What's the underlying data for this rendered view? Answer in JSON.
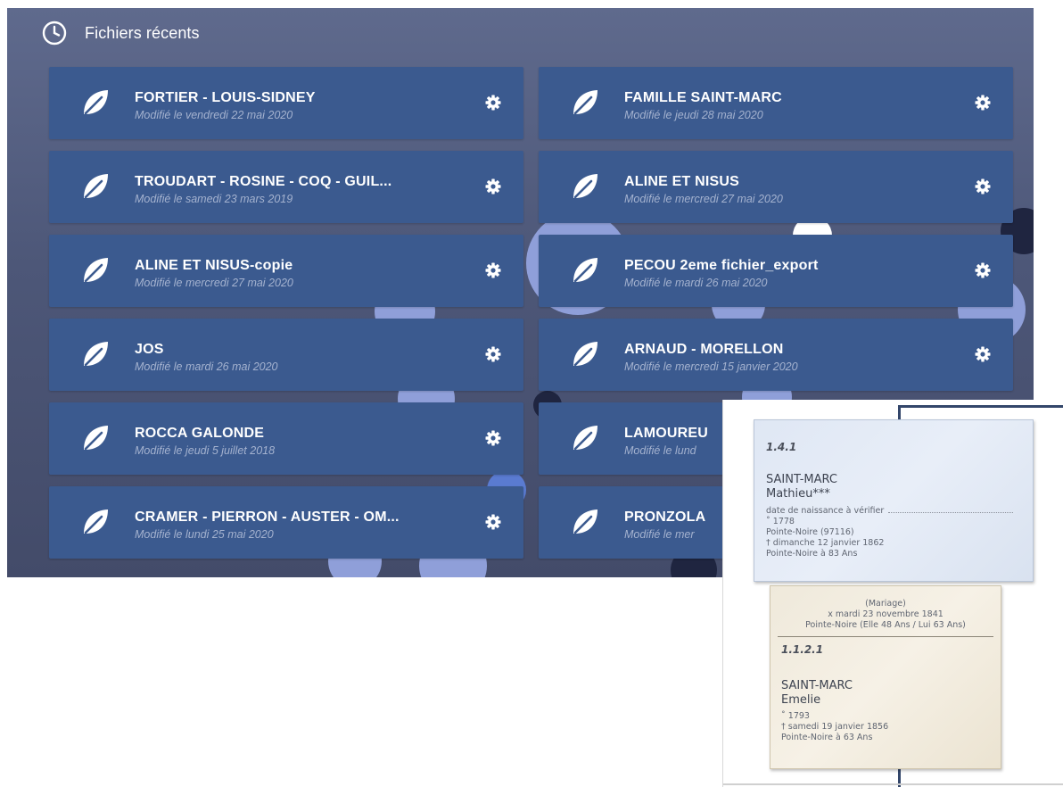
{
  "panel": {
    "title": "Fichiers récents",
    "files": [
      {
        "title": "FORTIER - LOUIS-SIDNEY",
        "modified": "Modifié le vendredi 22 mai 2020"
      },
      {
        "title": "FAMILLE SAINT-MARC",
        "modified": "Modifié le jeudi 28 mai 2020"
      },
      {
        "title": "TROUDART - ROSINE - COQ - GUIL...",
        "modified": "Modifié le samedi 23 mars 2019"
      },
      {
        "title": "ALINE ET NISUS",
        "modified": "Modifié le mercredi 27 mai 2020"
      },
      {
        "title": "ALINE ET NISUS-copie",
        "modified": "Modifié le mercredi 27 mai 2020"
      },
      {
        "title": "PECOU 2eme fichier_export",
        "modified": "Modifié le mardi 26 mai 2020"
      },
      {
        "title": "JOS",
        "modified": "Modifié le mardi 26 mai 2020"
      },
      {
        "title": "ARNAUD - MORELLON",
        "modified": "Modifié le mercredi 15 janvier 2020"
      },
      {
        "title": "ROCCA GALONDE",
        "modified": "Modifié le jeudi 5 juillet 2018"
      },
      {
        "title": "LAMOUREU",
        "modified": "Modifié le lund"
      },
      {
        "title": "CRAMER - PIERRON - AUSTER - OM...",
        "modified": "Modifié le lundi 25 mai 2020"
      },
      {
        "title": "PRONZOLA",
        "modified": "Modifié le mer"
      }
    ],
    "icons": {
      "header": "clock-icon",
      "file": "leaf-icon",
      "settings": "gear-icon"
    }
  },
  "tree": {
    "person1": {
      "code": "1.4.1",
      "surname": "SAINT-MARC",
      "given": "Mathieu***",
      "lines": [
        "date de naissance à vérifier",
        "˚ 1778",
        "Pointe-Noire (97116)",
        "† dimanche 12 janvier 1862",
        "Pointe-Noire à 83 Ans"
      ]
    },
    "marriage": [
      "(Mariage)",
      "x mardi 23 novembre 1841",
      "Pointe-Noire (Elle 48 Ans / Lui 63 Ans)"
    ],
    "person2": {
      "code": "1.1.2.1",
      "surname": "SAINT-MARC",
      "given": "Emelie",
      "lines": [
        "˚ 1793",
        "† samedi 19 janvier 1856",
        "Pointe-Noire à 63 Ans"
      ]
    }
  },
  "colors": {
    "panel_bg": "#545f82",
    "card": "#3b5a8f",
    "subtitle": "#a4b2cf",
    "deco": "#8fa0d8"
  }
}
